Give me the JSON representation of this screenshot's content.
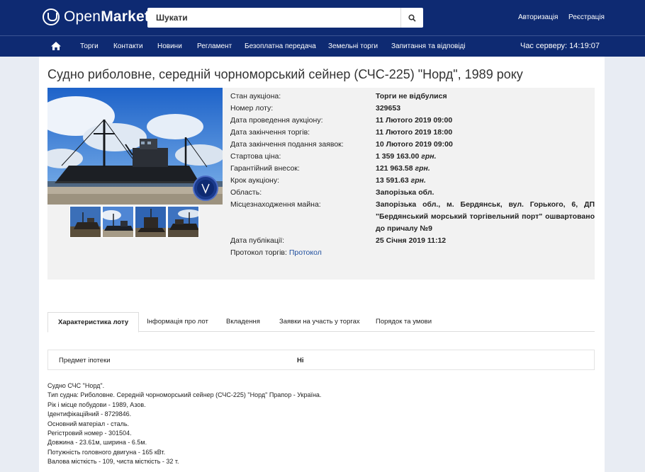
{
  "header": {
    "logo_light": "Open",
    "logo_bold": "Market",
    "search_placeholder": "Шукати",
    "login": "Авторизація",
    "register": "Реєстрація"
  },
  "nav": {
    "items": [
      "Торги",
      "Контакти",
      "Новини",
      "Регламент",
      "Безоплатна передача",
      "Земельні торги",
      "Запитання та відповіді"
    ],
    "server_time": "Час серверу: 14:19:07"
  },
  "lot": {
    "title": "Судно риболовне, середній чорноморський сейнер (СЧС-225) \"Норд\", 1989 року",
    "fields": [
      {
        "label": "Стан аукціона:",
        "value": "Торги не відбулися"
      },
      {
        "label": "Номер лоту:",
        "value": "329653"
      },
      {
        "label": "Дата проведення аукціону:",
        "value": "11 Лютого 2019 09:00"
      },
      {
        "label": "Дата закінчення торгів:",
        "value": "11 Лютого 2019 18:00"
      },
      {
        "label": "Дата закінчення подання заявок:",
        "value": "10 Лютого 2019 09:00"
      },
      {
        "label": "Стартова ціна:",
        "value": "1 359 163.00",
        "currency": "грн."
      },
      {
        "label": "Гарантійний внесок:",
        "value": "121 963.58",
        "currency": "грн."
      },
      {
        "label": "Крок аукціону:",
        "value": "13 591.63",
        "currency": "грн."
      },
      {
        "label": "Область:",
        "value": "Запорізька обл."
      },
      {
        "label": "Місцезнаходження майна:",
        "value": "Запорізька обл., м. Бердянськ, вул. Горького, 6, ДП \"Бердянський морський торгівельний порт\" ошвартовано до причалу №9"
      },
      {
        "label": "Дата публікації:",
        "value": "25 Січня 2019 11:12"
      }
    ],
    "protocol_label": "Протокол торгів:",
    "protocol_link": "Протокол"
  },
  "tabs": [
    "Характеристика лоту",
    "Інформація про лот",
    "Вкладення",
    "Заявки на участь у торгах",
    "Порядок та умови"
  ],
  "mortgage": {
    "label": "Предмет іпотеки",
    "value": "Ні"
  },
  "description": [
    "Судно СЧС \"Норд\".",
    "Тип судна: Риболовне. Середній чорноморський сейнер (СЧС-225) \"Норд\" Прапор - Україна.",
    "Рік і місце побудови - 1989, Азов.",
    "Ідентифікаційний - 8729846.",
    "Основний матеріал - сталь.",
    "Регістровий номер - 301504.",
    "Довжина - 23.61м, ширина - 6.5м.",
    "Потужність головного двигуна - 165 кВт.",
    "Валова місткість - 109, чиста місткість - 32 т."
  ],
  "colors": {
    "navy": "#0e2a72",
    "link": "#1f4e9e",
    "panel_grey": "#f2f2f2"
  },
  "icons": {
    "home": "home-icon",
    "search": "search-icon",
    "logo": "openmarket-logo-icon"
  }
}
